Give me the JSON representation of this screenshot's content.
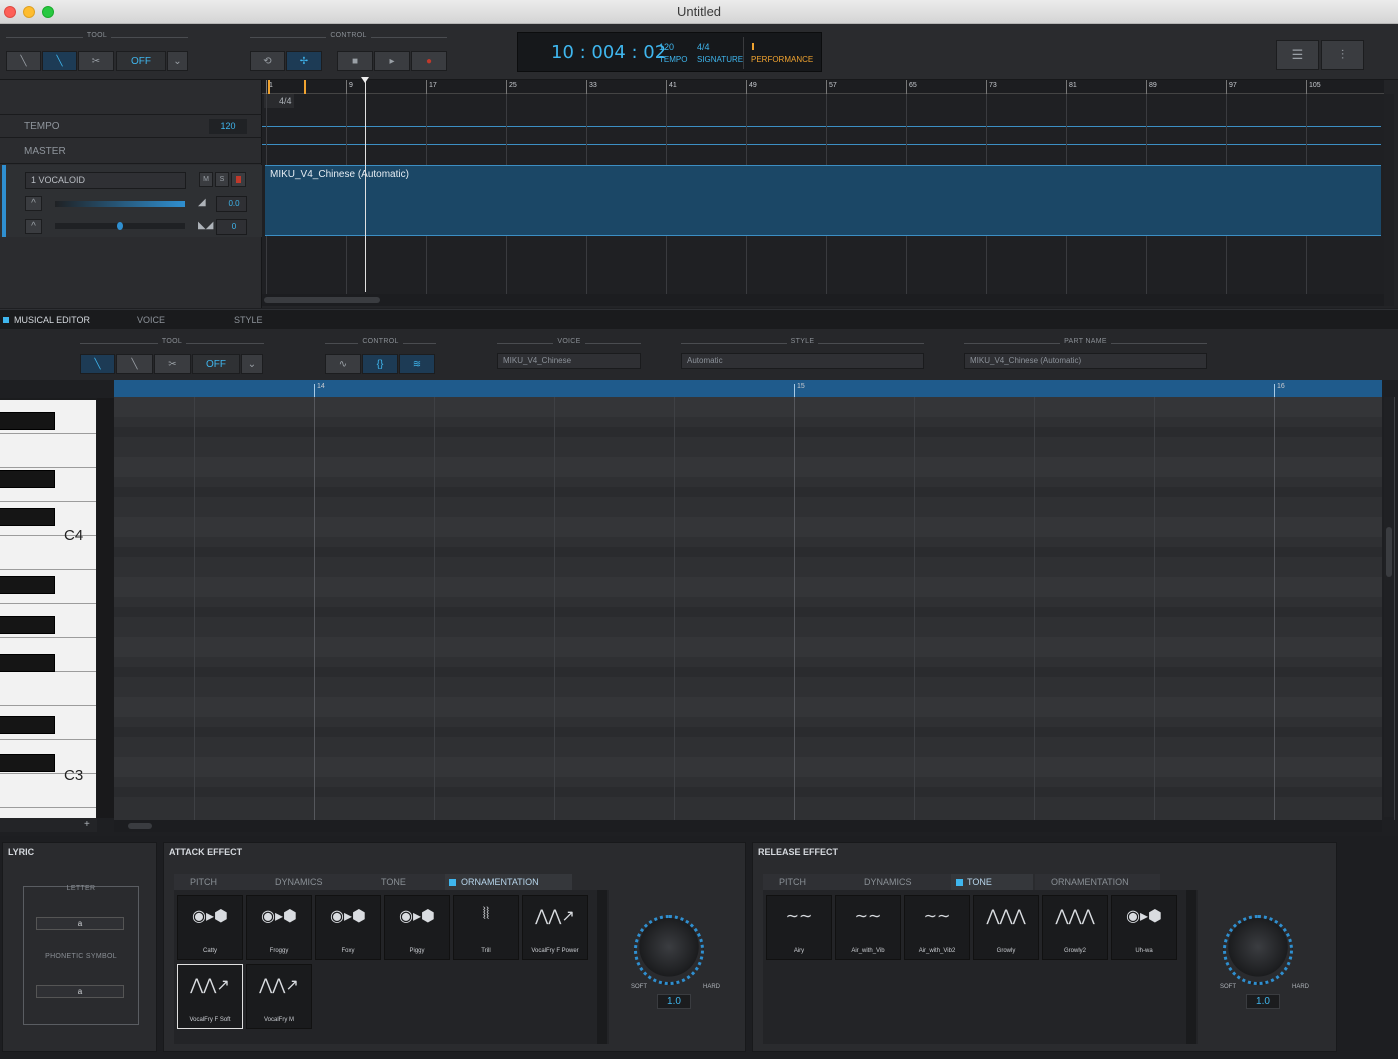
{
  "window": {
    "title": "Untitled"
  },
  "topbar": {
    "tool_label": "TOOL",
    "tool_off": "OFF",
    "control_label": "CONTROL",
    "lcd": {
      "time": "10 : 004 : 02",
      "tempo_value": "120",
      "tempo_label": "TEMPO",
      "signature_value": "4/4",
      "signature_label": "SIGNATURE",
      "performance_label": "PERFORMANCE"
    }
  },
  "tracks": {
    "tempo_label": "TEMPO",
    "tempo_value": "120",
    "master_label": "MASTER",
    "track1": {
      "name": "1 VOCALOID",
      "m": "M",
      "s": "S",
      "volume": "0.0",
      "pan": "0"
    },
    "signature": "4/4",
    "part_name": "MIKU_V4_Chinese (Automatic)",
    "ruler": [
      "1",
      "9",
      "17",
      "25",
      "33",
      "41",
      "49",
      "57",
      "65",
      "73",
      "81",
      "89",
      "97",
      "105"
    ]
  },
  "editor": {
    "tabs": [
      "MUSICAL EDITOR",
      "VOICE",
      "STYLE"
    ],
    "tool_label": "TOOL",
    "tool_off": "OFF",
    "control_label": "CONTROL",
    "voice_label": "VOICE",
    "voice_value": "MIKU_V4_Chinese",
    "style_label": "STYLE",
    "style_value": "Automatic",
    "partname_label": "PART NAME",
    "partname_value": "MIKU_V4_Chinese (Automatic)",
    "ruler": [
      "14",
      "15",
      "16"
    ],
    "keys": {
      "c4": "C4",
      "c3": "C3"
    }
  },
  "lyric": {
    "title": "LYRIC",
    "letter_label": "LETTER",
    "letter_value": "a",
    "phonetic_label": "PHONETIC SYMBOL",
    "phonetic_value": "a"
  },
  "attack": {
    "title": "ATTACK EFFECT",
    "tabs": [
      "PITCH",
      "DYNAMICS",
      "TONE",
      "ORNAMENTATION"
    ],
    "tiles": [
      "Catty",
      "Froggy",
      "Foxy",
      "Piggy",
      "Trill",
      "VocalFry F Power",
      "VocalFry F Soft",
      "VocalFry M"
    ],
    "soft": "SOFT",
    "hard": "HARD",
    "value": "1.0"
  },
  "release": {
    "title": "RELEASE EFFECT",
    "tabs": [
      "PITCH",
      "DYNAMICS",
      "TONE",
      "ORNAMENTATION"
    ],
    "tiles": [
      "Airy",
      "Air_with_Vib",
      "Air_with_Vib2",
      "Growly",
      "Growly2",
      "Uh-wa"
    ],
    "soft": "SOFT",
    "hard": "HARD",
    "value": "1.0"
  },
  "colors": {
    "accent": "#3fb6ee",
    "part": "#1b4766",
    "ruler": "#1f5b8c",
    "performance": "#f0a330"
  }
}
